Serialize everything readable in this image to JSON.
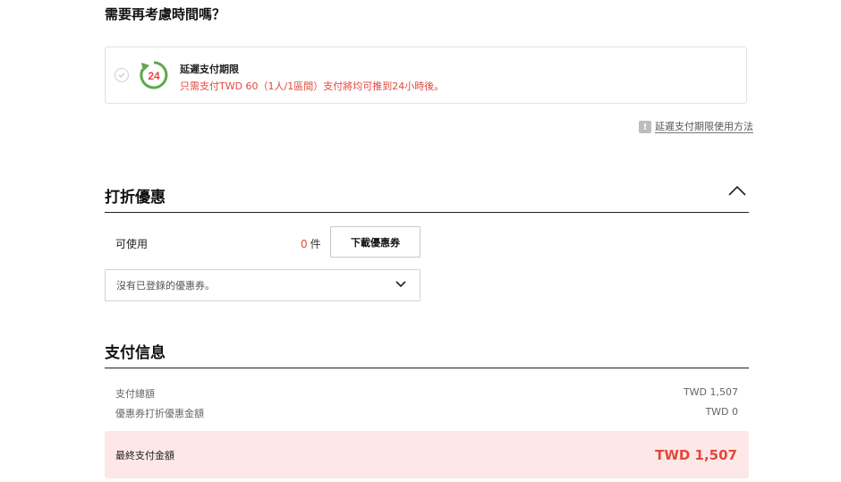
{
  "reconsider": {
    "title": "需要再考慮時間嗎？",
    "option_title": "延遲支付期限",
    "option_desc": "只需支付TWD 60（1人/1區間）支付將均可推到24小時後。",
    "badge_number": "24",
    "help_link": "延遲支付期限使用方法"
  },
  "discount": {
    "title": "打折優惠",
    "available_label": "可使用",
    "available_count": "0",
    "count_unit": "件",
    "download_button": "下載優惠券",
    "coupon_select": "沒有已登錄的優惠券。"
  },
  "payment": {
    "title": "支付信息",
    "rows": [
      {
        "label": "支付總額",
        "value": "TWD 1,507"
      },
      {
        "label": "優惠券打折優惠金額",
        "value": "TWD 0"
      }
    ],
    "final_label": "最終支付金額",
    "final_amount": "TWD 1,507"
  },
  "colors": {
    "accent_red": "#e2483d",
    "badge_green": "#5fa84b",
    "final_bg": "#fde7e7"
  },
  "icons": [
    "check-icon",
    "clock-24-icon",
    "info-icon",
    "chevron-up-icon",
    "chevron-down-icon"
  ]
}
